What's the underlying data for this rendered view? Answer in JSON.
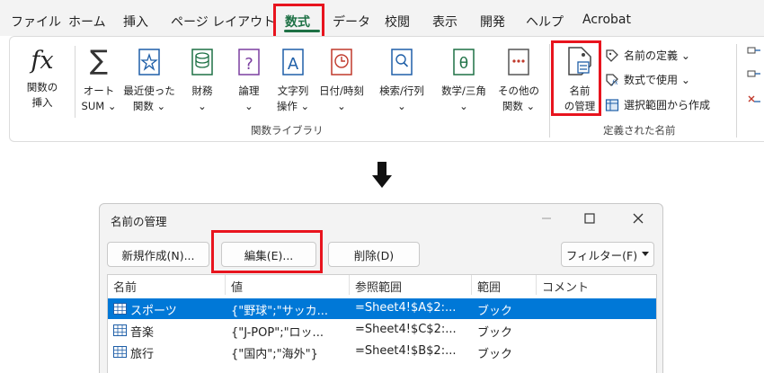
{
  "tabs": [
    "ファイル",
    "ホーム",
    "挿入",
    "ページ レイアウト",
    "数式",
    "データ",
    "校閲",
    "表示",
    "開発",
    "ヘルプ",
    "Acrobat"
  ],
  "ribbon": {
    "insert_function": {
      "icon": "fx",
      "line1": "関数の",
      "line2": "挿入"
    },
    "autosum": {
      "line1": "オート",
      "line2": "SUM ⌄"
    },
    "recent": {
      "line1": "最近使った",
      "line2": "関数 ⌄"
    },
    "financial": {
      "line1": "財務",
      "line2": "⌄"
    },
    "logical": {
      "line1": "論理",
      "line2": "⌄"
    },
    "text": {
      "line1": "文字列",
      "line2": "操作 ⌄"
    },
    "datetime": {
      "line1": "日付/時刻",
      "line2": "⌄"
    },
    "lookup": {
      "line1": "検索/行列",
      "line2": "⌄"
    },
    "math": {
      "line1": "数学/三角",
      "line2": "⌄"
    },
    "more": {
      "line1": "その他の",
      "line2": "関数 ⌄"
    },
    "library_label": "関数ライブラリ",
    "name_manager": {
      "line1": "名前",
      "line2": "の管理"
    },
    "define_name": "名前の定義 ⌄",
    "use_in_formula": "数式で使用 ⌄",
    "create_from_selection": "選択範囲から作成",
    "defined_names_label": "定義された名前"
  },
  "dialog": {
    "title": "名前の管理",
    "new_button": "新規作成(N)...",
    "edit_button": "編集(E)...",
    "delete_button": "削除(D)",
    "filter_button": "フィルター(F)",
    "columns": [
      "名前",
      "値",
      "参照範囲",
      "範囲",
      "コメント"
    ],
    "rows": [
      {
        "name": "スポーツ",
        "value": "{\"野球\";\"サッカ...",
        "ref": "=Sheet4!$A$2:...",
        "scope": "ブック",
        "comment": ""
      },
      {
        "name": "音楽",
        "value": "{\"J-POP\";\"ロッ...",
        "ref": "=Sheet4!$C$2:...",
        "scope": "ブック",
        "comment": ""
      },
      {
        "name": "旅行",
        "value": "{\"国内\";\"海外\"}",
        "ref": "=Sheet4!$B$2:...",
        "scope": "ブック",
        "comment": ""
      }
    ]
  },
  "colors": {
    "highlight": "#e8141e",
    "selection": "#0078d7",
    "excel_green": "#1e7145"
  }
}
